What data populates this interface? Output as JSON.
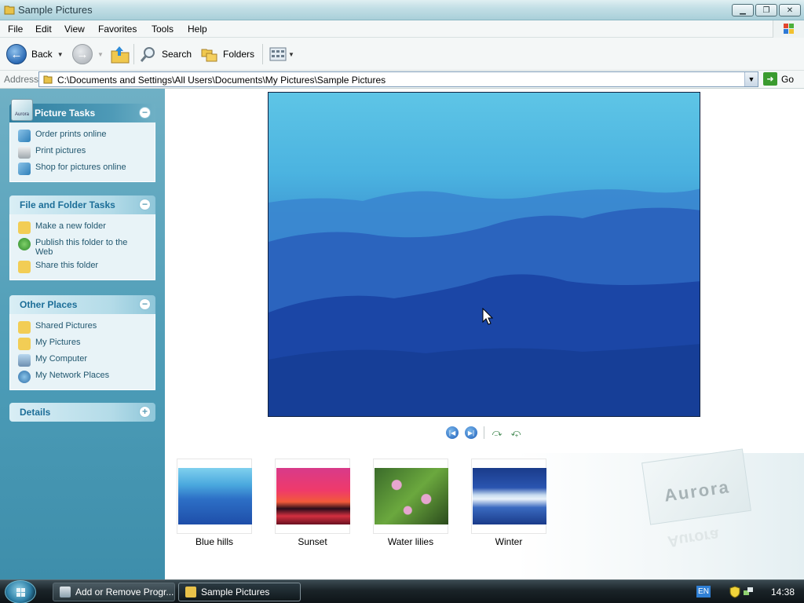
{
  "window": {
    "title": "Sample Pictures"
  },
  "menu": [
    "File",
    "Edit",
    "View",
    "Favorites",
    "Tools",
    "Help"
  ],
  "toolbar": {
    "back_label": "Back",
    "search_label": "Search",
    "folders_label": "Folders"
  },
  "address": {
    "label": "Address",
    "path": "C:\\Documents and Settings\\All Users\\Documents\\My Pictures\\Sample Pictures",
    "go_label": "Go"
  },
  "taskpane": {
    "picture_tasks": {
      "title": "Picture Tasks",
      "items": [
        "Order prints online",
        "Print pictures",
        "Shop for pictures online"
      ]
    },
    "file_tasks": {
      "title": "File and Folder Tasks",
      "items": [
        "Make a new folder",
        "Publish this folder to the Web",
        "Share this folder"
      ]
    },
    "other_places": {
      "title": "Other Places",
      "items": [
        "Shared Pictures",
        "My Pictures",
        "My Computer",
        "My Network Places"
      ]
    },
    "details": {
      "title": "Details"
    }
  },
  "thumbnails": [
    "Blue hills",
    "Sunset",
    "Water lilies",
    "Winter"
  ],
  "watermark": "Aurora",
  "taskbar": {
    "buttons": [
      "Add or Remove Progr...",
      "Sample Pictures"
    ],
    "lang": "EN",
    "time": "14:38"
  },
  "colors": {
    "accent": "#1c6e98",
    "taskpane_bg": "#4b9bb6",
    "taskbar_bg": "#1a2328"
  }
}
